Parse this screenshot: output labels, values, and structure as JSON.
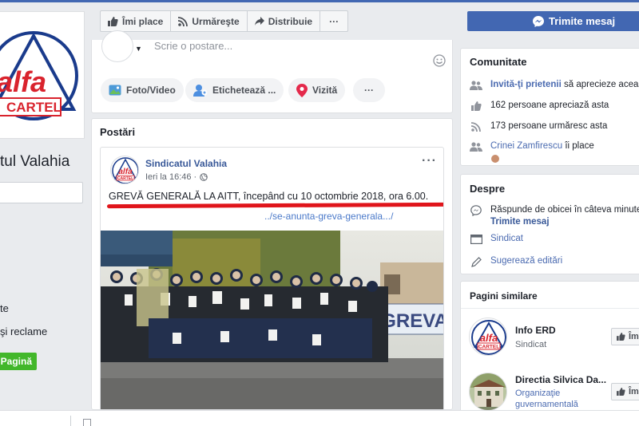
{
  "left": {
    "logo_text": "alfa",
    "logo_subtext": "CARTEL",
    "page_name": "tul Valahia",
    "links": [
      "te",
      "şi reclame"
    ],
    "create_page_label": "Pagină"
  },
  "action_bar": {
    "like_label": "Îmi place",
    "follow_label": "Urmăreşte",
    "share_label": "Distribuie",
    "more_label": "···"
  },
  "send_message_label": "Trimite mesaj",
  "composer": {
    "placeholder": "Scrie o postare...",
    "chips": [
      "Foto/Video",
      "Etichetează ...",
      "Vizită"
    ],
    "more_label": "···"
  },
  "posts": {
    "title": "Postări",
    "post": {
      "author": "Sindicatul Valahia",
      "time": "Ieri la 16:46 ·",
      "text": "GREVĂ GENERALĂ LA AITT, începând cu 10 octombrie 2018, ora 6.00.",
      "link": "../se-anunta-greva-generala.../",
      "photo_banner": "GREVA",
      "more": "···"
    }
  },
  "community": {
    "title": "Comunitate",
    "invite_link": "Invită-ţi prietenii",
    "invite_rest": "să aprecieze această",
    "likes": "162 persoane apreciază asta",
    "follows": "173 persoane urmăresc asta",
    "friend_name": "Crinei Zamfirescu",
    "friend_rest": "îi place"
  },
  "about": {
    "title": "Despre",
    "response": "Răspunde de obicei în câteva minute",
    "send_message": "Trimite mesaj",
    "category": "Sindicat",
    "suggest_edits": "Sugerează editări"
  },
  "similar": {
    "title": "Pagini similare",
    "pages": [
      {
        "name": "Info ERD",
        "category": "Sindicat",
        "like": "Îm"
      },
      {
        "name": "Directia Silvica Da...",
        "category_line1": "Organizaţie",
        "category_line2": "guvernamentală",
        "like": "Îm"
      }
    ]
  },
  "colors": {
    "fb_blue": "#4267b2",
    "link_blue": "#385898",
    "underline_red": "#e0151b",
    "green": "#42b72a",
    "logo_red": "#d9232d",
    "logo_navy": "#1a3b8c"
  }
}
